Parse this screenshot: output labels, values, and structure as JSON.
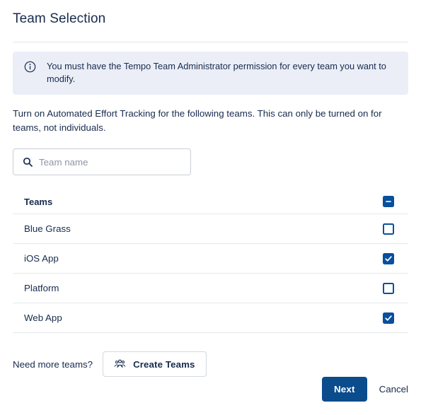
{
  "page": {
    "title": "Team Selection"
  },
  "banner": {
    "icon": "info-circle-icon",
    "text": "You must have the Tempo Team Administrator permission for every team you want to modify."
  },
  "description": "Turn on Automated Effort Tracking for the following teams. This can only be turned on for teams, not individuals.",
  "search": {
    "icon": "search-icon",
    "placeholder": "Team name",
    "value": ""
  },
  "table": {
    "header": {
      "label": "Teams",
      "checkbox_state": "indeterminate"
    },
    "rows": [
      {
        "label": "Blue Grass",
        "checkbox_state": "unchecked"
      },
      {
        "label": "iOS App",
        "checkbox_state": "checked"
      },
      {
        "label": "Platform",
        "checkbox_state": "unchecked"
      },
      {
        "label": "Web App",
        "checkbox_state": "checked"
      }
    ]
  },
  "create": {
    "prompt": "Need more teams?",
    "button_label": "Create Teams",
    "button_icon": "people-group-icon"
  },
  "footer": {
    "primary_label": "Next",
    "secondary_label": "Cancel"
  },
  "colors": {
    "primary": "#0B4C8C",
    "checkbox": "#084F9D",
    "banner_bg": "#EBEEF7",
    "text": "#172B4D",
    "divider": "#E6E8EC"
  }
}
